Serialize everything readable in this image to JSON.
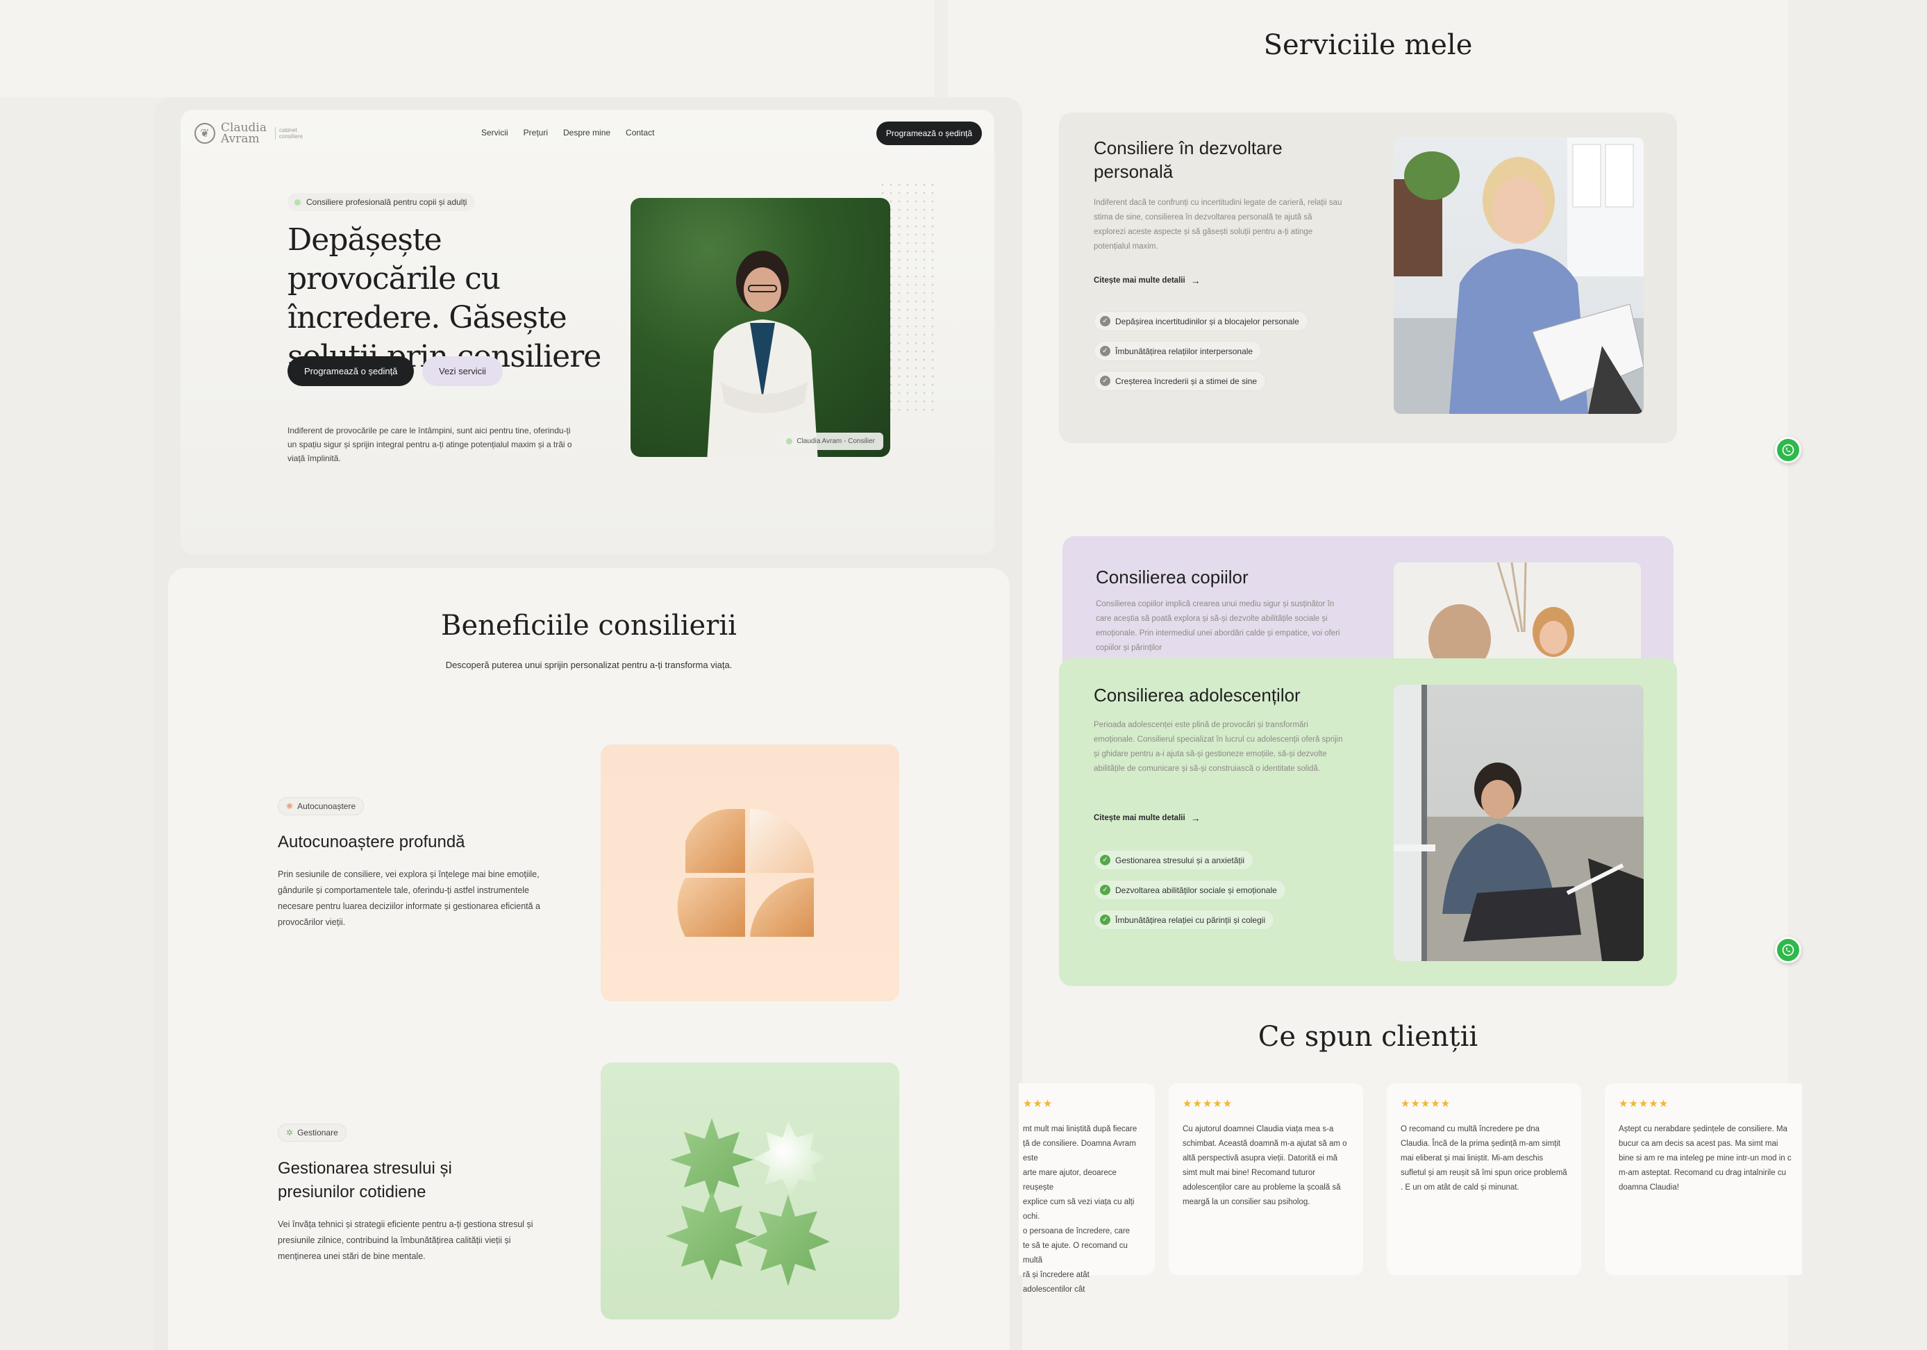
{
  "nav": {
    "logo_name": "Claudia Avram",
    "logo_sub": "cabinet consiliere",
    "links": [
      "Servicii",
      "Prețuri",
      "Despre mine",
      "Contact"
    ],
    "cta": "Programează o ședință"
  },
  "hero": {
    "badge": "Consiliere profesională pentru copii și adulți",
    "title": "Depășește provocările cu încredere. Găsește soluții prin consiliere",
    "btn_primary": "Programează o ședință",
    "btn_secondary": "Vezi servicii",
    "description": "Indiferent de provocările pe care le întâmpini, sunt aici pentru tine, oferindu-ți un spațiu sigur și sprijin integral pentru a-ți atinge potențialul maxim și a trăi o viață împlinită.",
    "photo_tag": "Claudia Avram - Consilier"
  },
  "benefits": {
    "title": "Beneficiile consilierii",
    "subtitle": "Descoperă puterea unui sprijin personalizat pentru a-ți transforma viața.",
    "items": [
      {
        "pill": "Autocunoaștere",
        "title": "Autocunoaștere profundă",
        "text": "Prin sesiunile de consiliere, vei explora și înțelege mai bine emoțiile, gândurile și comportamentele tale, oferindu-ți astfel instrumentele necesare pentru luarea deciziilor informate și gestionarea eficientă a provocărilor vieții."
      },
      {
        "pill": "Gestionare",
        "title": "Gestionarea stresului și presiunilor cotidiene",
        "text": "Vei învăța tehnici și strategii eficiente pentru a-ți gestiona stresul și presiunile zilnice, contribuind la îmbunătățirea calității vieții și menținerea unei stări de bine mentale."
      }
    ]
  },
  "services": {
    "title": "Serviciile mele",
    "more_label": "Citește mai multe detalii",
    "cards": [
      {
        "title": "Consiliere în dezvoltare personală",
        "desc": "Indiferent dacă te confrunți cu incertitudini legate de carieră, relații sau stima de sine, consilierea în dezvoltarea personală te ajută să explorezi aceste aspecte și să găsești soluții pentru a-ți atinge potențialul maxim.",
        "checks": [
          "Depășirea incertitudinilor și a blocajelor personale",
          "Îmbunătățirea relațiilor interpersonale",
          "Creșterea încrederii și a stimei de sine"
        ]
      },
      {
        "title": "Consilierea copiilor",
        "desc": "Consilierea copiilor implică crearea unui mediu sigur și susținător în care aceștia să poată explora și să-și dezvolte abilitățile sociale și emoționale. Prin intermediul unei abordări calde și empatice, voi oferi copiilor și părinților"
      },
      {
        "title": "Consilierea adolescenților",
        "desc": "Perioada adolescenței este plină de provocări și transformări emoționale. Consilierul specializat în lucrul cu adolescenții oferă sprijin și ghidare pentru a-i ajuta să-și gestioneze emoțiile, să-și dezvolte abilitățile de comunicare și să-și construiască o identitate solidă.",
        "checks": [
          "Gestionarea stresului și a anxietății",
          "Dezvoltarea abilităților sociale și emoționale",
          "Îmbunătățirea relației cu părinții și colegii"
        ]
      }
    ]
  },
  "testimonials": {
    "title": "Ce spun clienții",
    "stars": "★★★★★",
    "stars_partial": "★★★",
    "items": [
      "mt mult mai liniștită după fiecare\nță de consiliere. Doamna Avram este\narte mare ajutor, deoarece reușește\nexplice cum să vezi viața cu alți ochi.\no persoana de încredere, care\nte să te ajute. O recomand cu multă\nră și încredere atât adolescenților cât\nnților!",
      "Cu ajutorul doamnei Claudia viața mea s-a schimbat. Această doamnă m-a ajutat să am o altă perspectivă asupra vieții. Datorită ei mă simt mult mai bine! Recomand tuturor adolescenților care au probleme la școală să meargă la un consilier sau psiholog.",
      "O recomand cu multă încredere pe dna Claudia. Încă de la prima ședință m-am simțit mai eliberat și mai liniștit. Mi-am deschis sufletul și am reușit să îmi spun orice problemă . E un om atât de cald și minunat.",
      "Aștept cu nerabdare ședințele de consiliere. Ma bucur ca am decis sa acest pas. Ma simt mai bine si am re ma inteleg pe mine intr-un mod in c m-am asteptat. Recomand cu drag intalnirile cu doamna Claudia!"
    ]
  },
  "colors": {
    "dark": "#1e2022",
    "lavender": "#e4dcec",
    "mint": "#d5eccb",
    "peach": "#fbe3cf",
    "whatsapp": "#2fb84b",
    "star": "#f3b531"
  }
}
